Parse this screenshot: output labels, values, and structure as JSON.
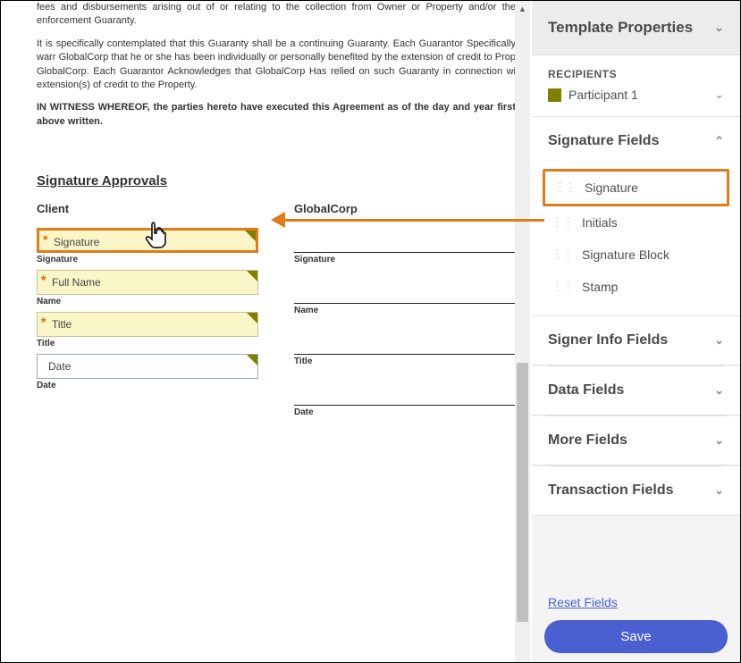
{
  "document": {
    "para1": "fees and disbursements arising out of or relating to the collection from Owner or Property and/or the enforcement Guaranty.",
    "para2": "It is specifically contemplated that this Guaranty shall be a continuing Guaranty. Each Guarantor Specifically warr GlobalCorp that he or she has been individually or personally benefited by the extension of credit to Prop GlobalCorp. Each Guarantor Acknowledges that GlobalCorp Has relied on such Guaranty in connection wi extension(s) of credit to the Property.",
    "para3": "IN WITNESS WHEREOF, the parties hereto have executed this Agreement as of the day and year first above written.",
    "heading": "Signature Approvals",
    "client": {
      "header": "Client",
      "signature_field": "Signature",
      "signature_label": "Signature",
      "name_field": "Full Name",
      "name_label": "Name",
      "title_field": "Title",
      "title_label": "Title",
      "date_field": "Date",
      "date_label": "Date"
    },
    "corp": {
      "header": "GlobalCorp",
      "signature_label": "Signature",
      "name_label": "Name",
      "title_label": "Title",
      "date_label": "Date"
    }
  },
  "sidebar": {
    "panel_title": "Template Properties",
    "recipients_label": "RECIPIENTS",
    "participant": "Participant 1",
    "sections": {
      "signature": {
        "title": "Signature Fields",
        "items": [
          "Signature",
          "Initials",
          "Signature Block",
          "Stamp"
        ]
      },
      "signer_info": "Signer Info Fields",
      "data_fields": "Data Fields",
      "more_fields": "More Fields",
      "transaction": "Transaction Fields"
    },
    "reset": "Reset Fields",
    "save": "Save"
  }
}
